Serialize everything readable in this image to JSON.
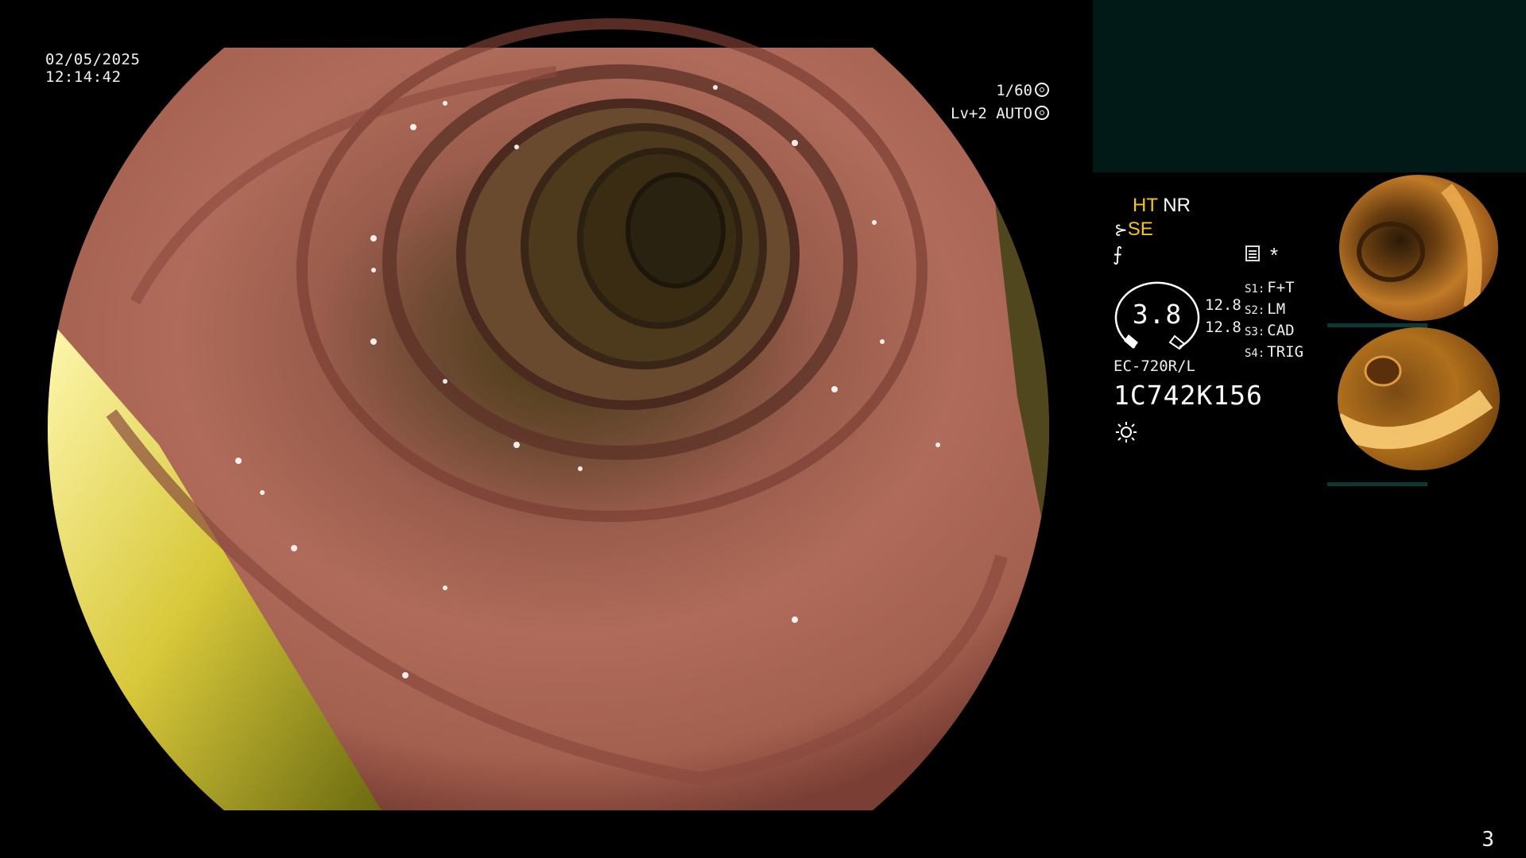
{
  "overlay": {
    "date": "02/05/2025",
    "time": "12:14:42",
    "shutter": "1/60",
    "brightness": "Lv+2 AUTO"
  },
  "settings": {
    "mode_1_label": "HT",
    "mode_1_value": "NR",
    "mode_2_label": "SE",
    "zoom": "3.8",
    "zoom_side_1": "12.8",
    "zoom_side_2": "12.8",
    "scope_switches": [
      {
        "key": "S1:",
        "value": "F+T"
      },
      {
        "key": "S2:",
        "value": "LM"
      },
      {
        "key": "S3:",
        "value": "CAD"
      },
      {
        "key": "S4:",
        "value": "TRIG"
      }
    ],
    "scope_model": "EC-720R/L",
    "scope_serial": "1C742K156"
  },
  "icons": [
    "brightness-icon",
    "enhancement-icon",
    "contrast-icon",
    "document-icon",
    "light-icon"
  ],
  "colors": {
    "accent_yellow": "#f5c518",
    "panel_teal": "#021a17"
  },
  "page_number": "3"
}
